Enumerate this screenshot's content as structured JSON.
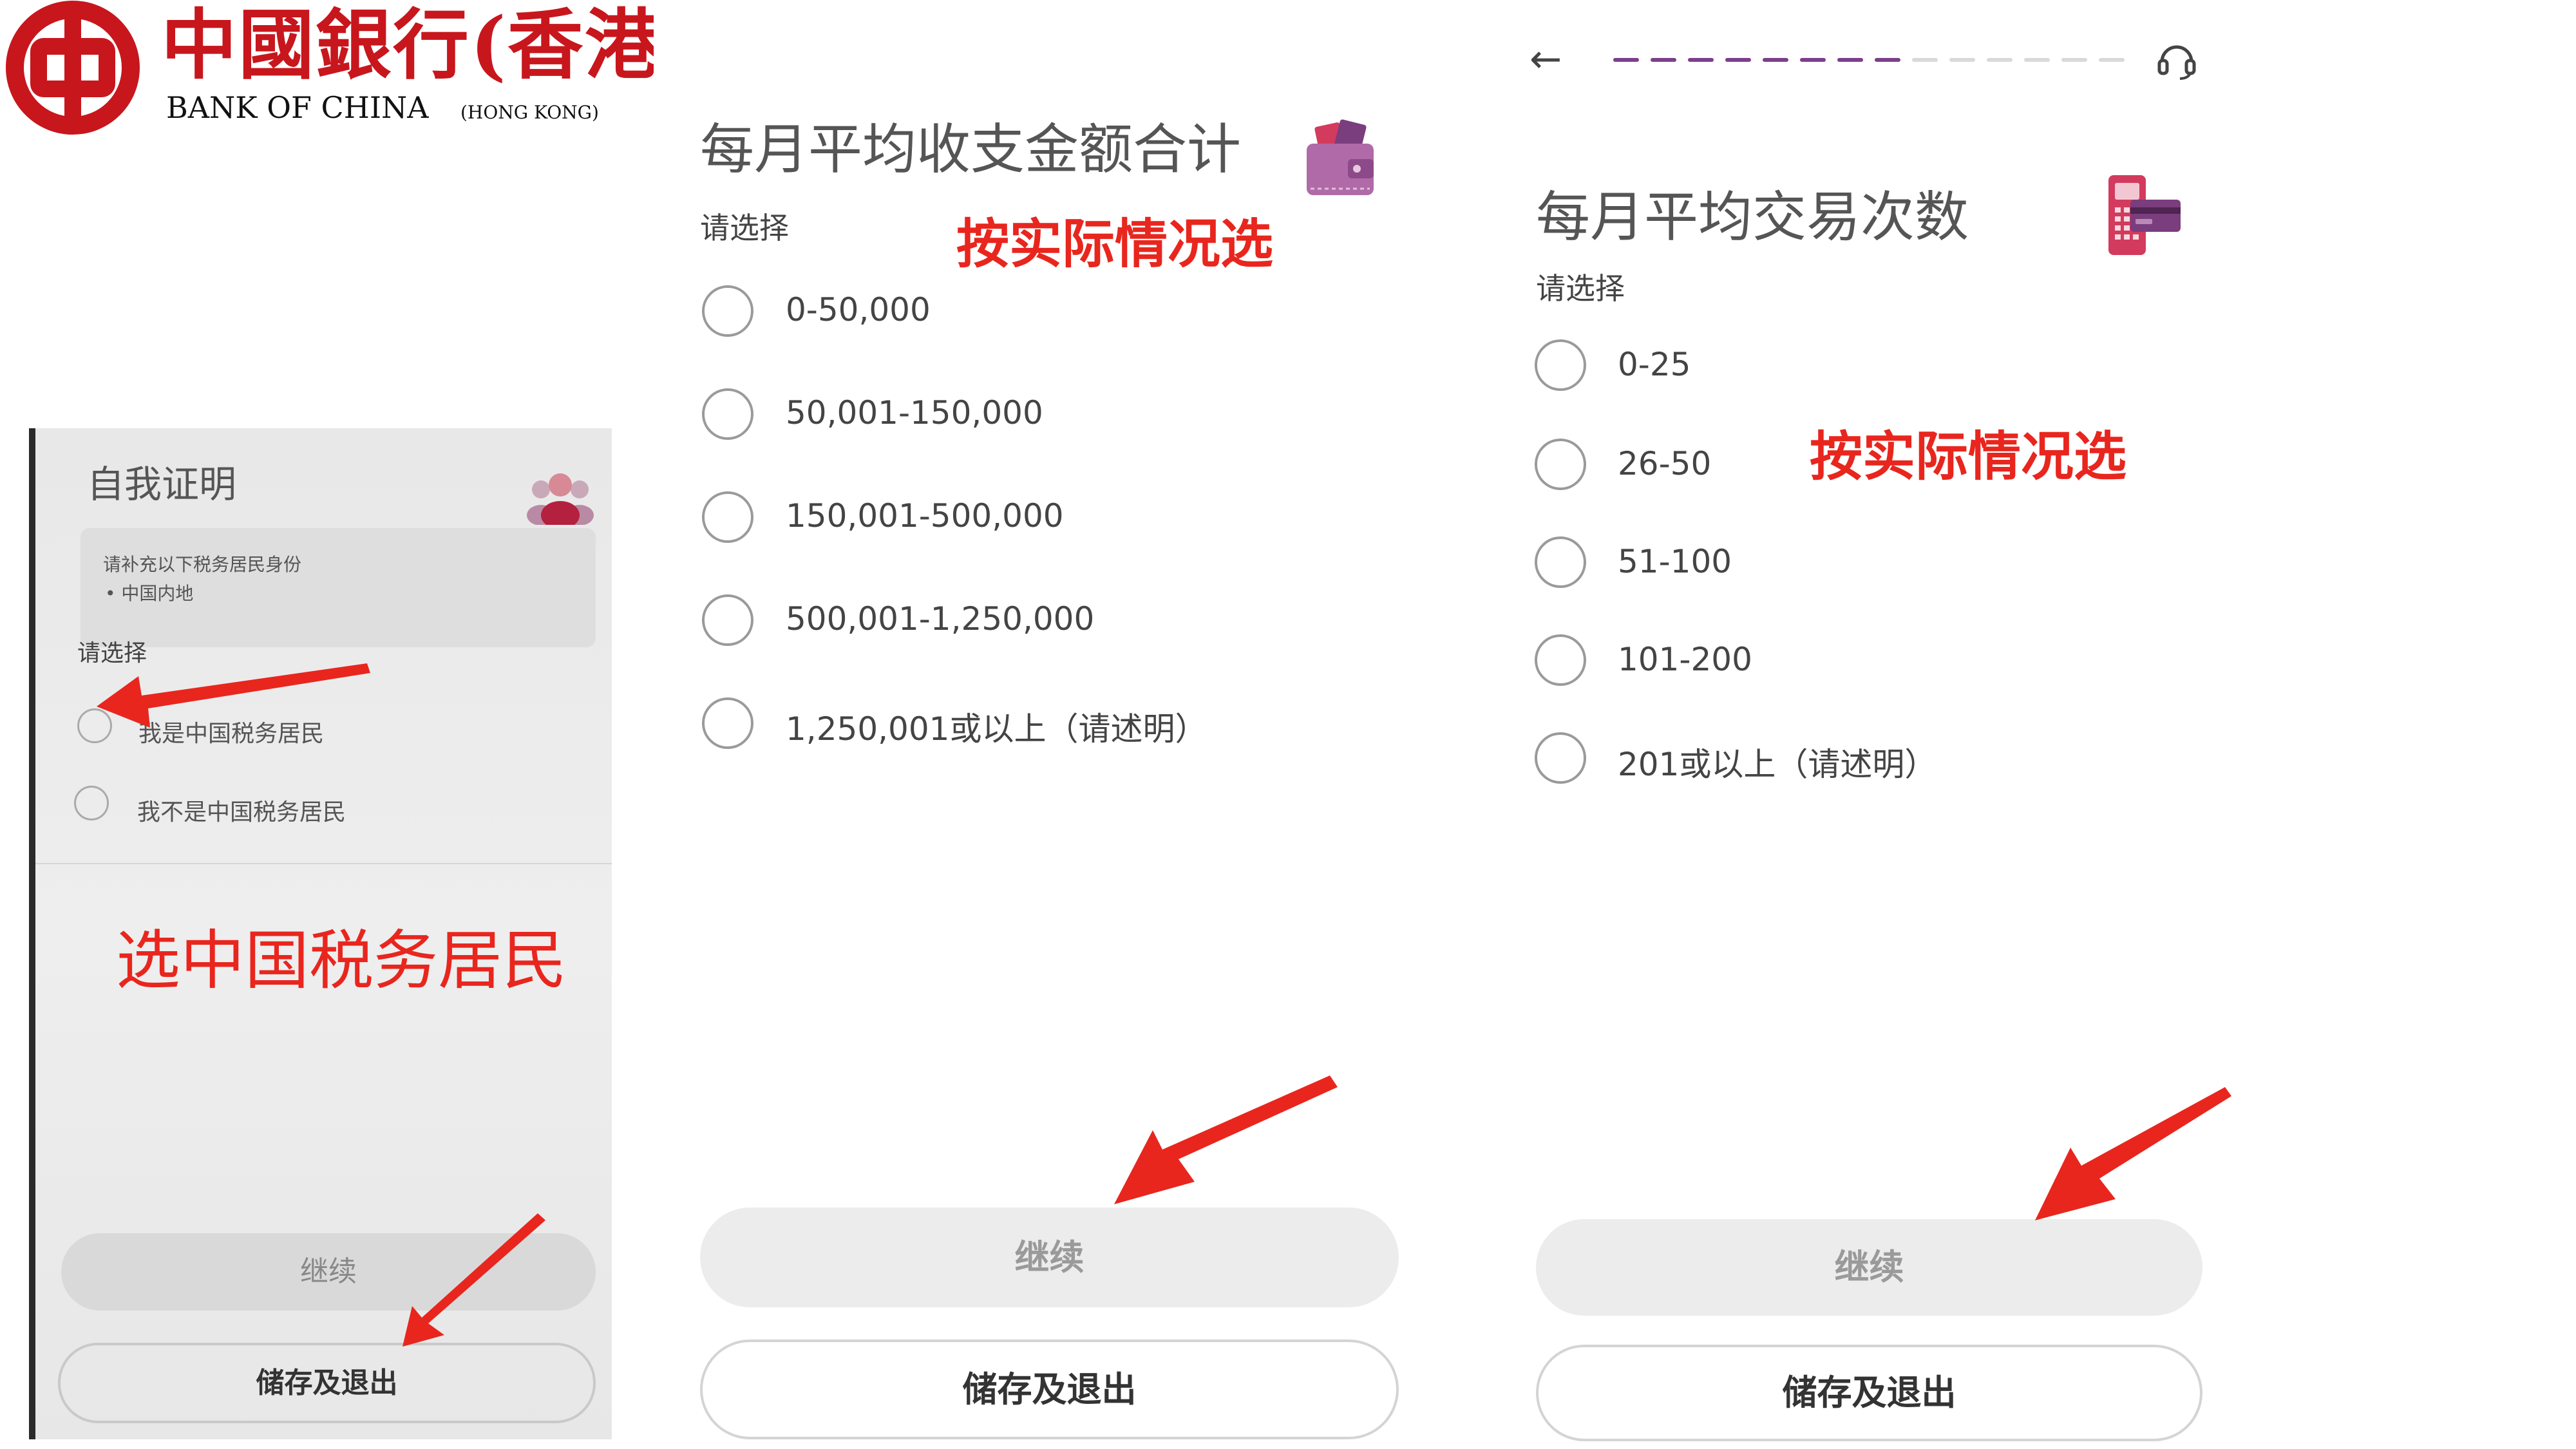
{
  "logo": {
    "chinese": "中國銀行(香港)",
    "english": "BANK OF CHINA",
    "hk": "(HONG KONG)",
    "brand_color": "#c8161d"
  },
  "panel1": {
    "title": "自我证明",
    "note_lines": [
      "请补充以下税务居民身份",
      "•  中国内地"
    ],
    "choose_label": "请选择",
    "options": [
      "我是中国税务居民",
      "我不是中国税务居民"
    ],
    "annotation": "选中国税务居民",
    "continue_label": "继续",
    "save_exit_label": "储存及退出"
  },
  "panel2": {
    "title": "每月平均收支金额合计",
    "choose_label": "请选择",
    "annotation": "按实际情况选",
    "options": [
      "0-50,000",
      "50,001-150,000",
      "150,001-500,000",
      "500,001-1,250,000",
      "1,250,001或以上（请述明）"
    ],
    "continue_label": "继续",
    "save_exit_label": "储存及退出"
  },
  "panel3": {
    "title": "每月平均交易次数",
    "choose_label": "请选择",
    "annotation": "按实际情况选",
    "options": [
      "0-25",
      "26-50",
      "51-100",
      "101-200",
      "201或以上（请述明）"
    ],
    "continue_label": "继续",
    "save_exit_label": "储存及退出",
    "progress_total": 14,
    "progress_completed": 8,
    "progress_color": "#7b3f8c"
  },
  "annotation_color": "#e8261e"
}
